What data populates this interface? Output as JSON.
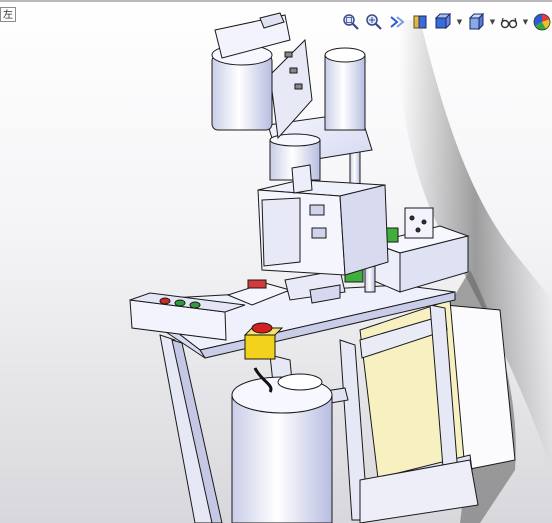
{
  "viewport": {
    "corner_label": "左",
    "background_top": "#ffffff",
    "background_bottom": "#d8d8dc"
  },
  "toolbar": {
    "items": [
      {
        "name": "zoom-to-fit",
        "icon": "magnifier-fit-icon"
      },
      {
        "name": "zoom-to-area",
        "icon": "magnifier-area-icon"
      },
      {
        "name": "previous-view",
        "icon": "previous-view-icon"
      },
      {
        "name": "section-view",
        "icon": "section-view-icon"
      },
      {
        "name": "view-orientation",
        "icon": "cube-view-icon",
        "dropdown": true
      },
      {
        "name": "display-style",
        "icon": "display-style-icon",
        "dropdown": true
      },
      {
        "name": "hide-show-items",
        "icon": "eye-glasses-icon",
        "dropdown": true
      },
      {
        "name": "edit-appearance",
        "icon": "color-ball-icon"
      }
    ]
  },
  "colors": {
    "machine_body": "#eef0fb",
    "machine_shade": "#c9cde8",
    "outline": "#1a1a1a",
    "green_button": "#2e9c3a",
    "red_button": "#cc2a2a",
    "estop_yellow": "#f2d21c",
    "estop_red": "#d41f1f",
    "cabinet_panel": "#f7f1c2",
    "green_part": "#3fae3a",
    "orange_part": "#e07a3a",
    "shadow": "#6e6e6e"
  }
}
